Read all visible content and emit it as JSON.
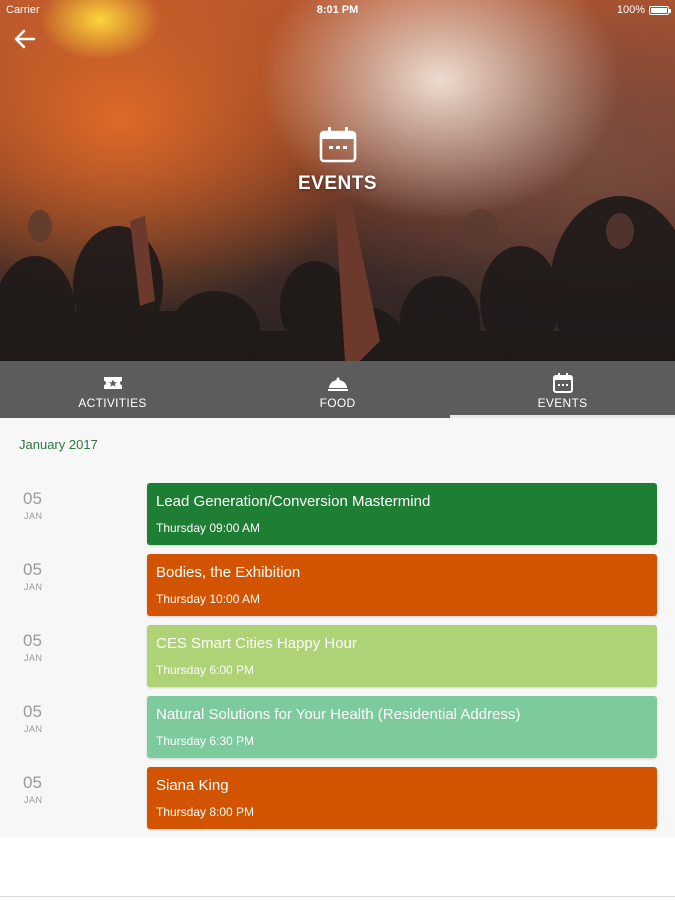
{
  "status_bar": {
    "carrier": "Carrier",
    "time": "8:01 PM",
    "battery": "100%"
  },
  "header": {
    "back_icon": "back-arrow-icon",
    "title": "EVENTS",
    "title_icon": "calendar-icon"
  },
  "tabs": [
    {
      "label": "ACTIVITIES",
      "icon": "ticket-star-icon",
      "active": false
    },
    {
      "label": "FOOD",
      "icon": "food-cloche-icon",
      "active": false
    },
    {
      "label": "EVENTS",
      "icon": "calendar-icon",
      "active": true
    }
  ],
  "month_heading": "January 2017",
  "events": [
    {
      "day": "05",
      "month": "JAN",
      "title": "Lead Generation/Conversion Mastermind",
      "time": "Thursday 09:00 AM",
      "color": "#1e7e34"
    },
    {
      "day": "05",
      "month": "JAN",
      "title": "Bodies, the Exhibition",
      "time": "Thursday 10:00 AM",
      "color": "#d35400"
    },
    {
      "day": "05",
      "month": "JAN",
      "title": "CES Smart Cities Happy Hour",
      "time": "Thursday 6:00 PM",
      "color": "#aed276"
    },
    {
      "day": "05",
      "month": "JAN",
      "title": "Natural Solutions for Your Health (Residential Address)",
      "time": "Thursday 6:30 PM",
      "color": "#7dca9c"
    },
    {
      "day": "05",
      "month": "JAN",
      "title": "Siana King",
      "time": "Thursday 8:00 PM",
      "color": "#d35400"
    }
  ],
  "colors": {
    "tabbar": "#5c5c5c",
    "accent_green": "#2b7a3d"
  }
}
